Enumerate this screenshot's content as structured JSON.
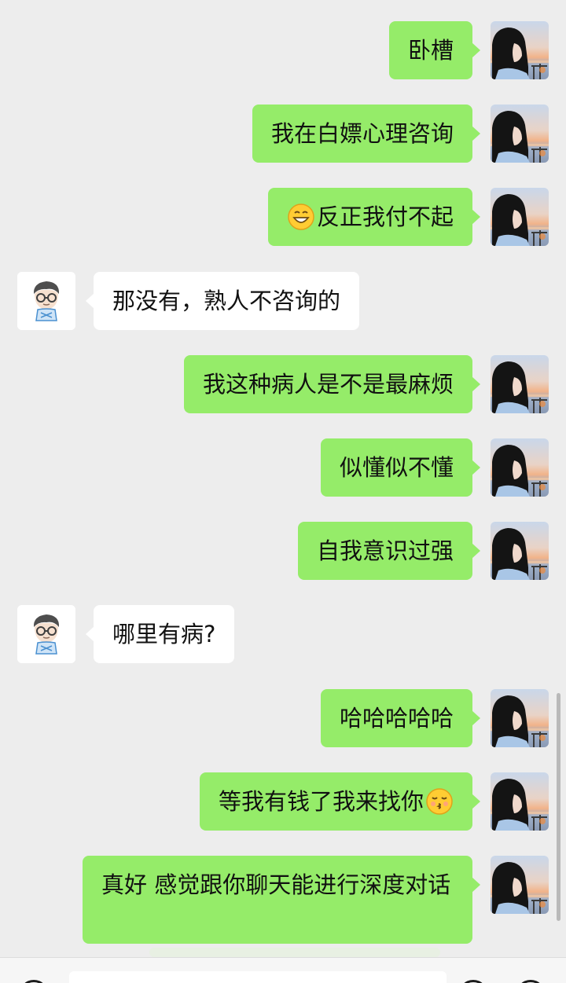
{
  "messages": [
    {
      "side": "me",
      "text": "卧槽"
    },
    {
      "side": "me",
      "text": "我在白嫖心理咨询"
    },
    {
      "side": "me",
      "emoji_before": "grinning-face-emoji",
      "text": "反正我付不起"
    },
    {
      "side": "other",
      "text": "那没有，熟人不咨询的"
    },
    {
      "side": "me",
      "text": "我这种病人是不是最麻烦"
    },
    {
      "side": "me",
      "text": "似懂似不懂"
    },
    {
      "side": "me",
      "text": "自我意识过强"
    },
    {
      "side": "other",
      "text": "哪里有病?"
    },
    {
      "side": "me",
      "text": "哈哈哈哈哈"
    },
    {
      "side": "me",
      "emoji_after": "kissing-face-emoji",
      "text": "等我有钱了我来找你"
    },
    {
      "side": "me",
      "text": "真好 感觉跟你聊天能进行深度对话"
    }
  ],
  "colors": {
    "background": "#ededed",
    "my_bubble": "#95ec69",
    "other_bubble": "#ffffff",
    "text": "#111111"
  },
  "icons": {
    "my_avatar": "girl-photo-avatar",
    "other_avatar": "cartoon-man-glasses-avatar",
    "voice": "voice-icon",
    "emoji": "emoji-icon",
    "plus": "plus-icon"
  }
}
